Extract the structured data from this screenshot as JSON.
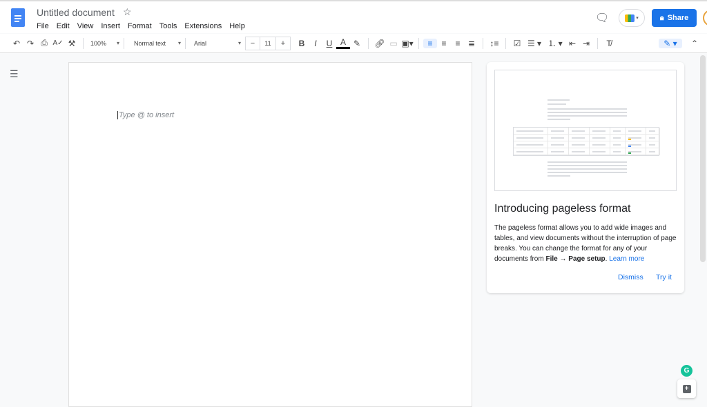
{
  "header": {
    "title": "Untitled document",
    "menu": [
      "File",
      "Edit",
      "View",
      "Insert",
      "Format",
      "Tools",
      "Extensions",
      "Help"
    ],
    "share_label": "Share"
  },
  "toolbar": {
    "zoom": "100%",
    "style": "Normal text",
    "font": "Arial",
    "font_size": "11"
  },
  "document": {
    "placeholder": "Type @ to insert"
  },
  "panel": {
    "title": "Introducing pageless format",
    "body_1": "The pageless format allows you to add wide images and tables, and view documents without the interruption of page breaks. You can change the format for any of your documents from ",
    "body_file": "File",
    "body_arrow": " → ",
    "body_setup": "Page setup",
    "body_end": ". ",
    "learn_more": "Learn more",
    "dismiss": "Dismiss",
    "try_it": "Try it"
  },
  "colors": {
    "accent": "#1a73e8",
    "grammarly": "#15c39a"
  }
}
